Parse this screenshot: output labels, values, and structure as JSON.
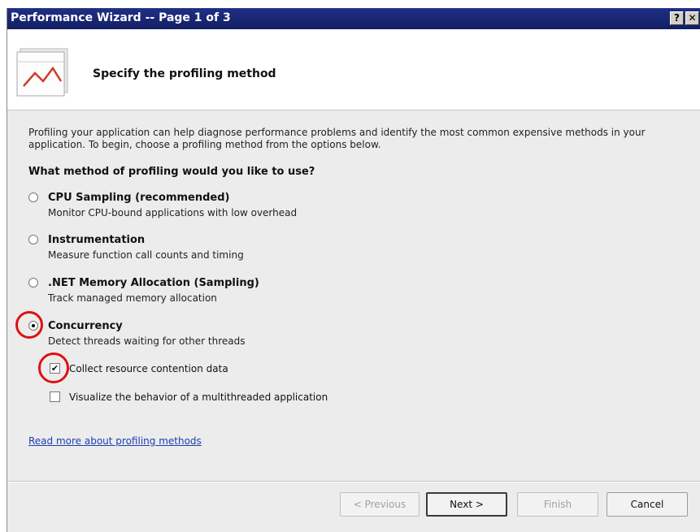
{
  "window": {
    "title": "Performance Wizard -- Page 1 of 3",
    "help_label": "?",
    "close_label": "✕"
  },
  "header": {
    "title": "Specify the profiling method",
    "icon": "line-chart-icon"
  },
  "content": {
    "intro": "Profiling your application can help diagnose performance problems and identify the most common expensive methods in your application. To begin, choose a profiling method from the options below.",
    "question": "What method of profiling would you like to use?",
    "options": [
      {
        "label": "CPU Sampling (recommended)",
        "description": "Monitor CPU-bound applications with low overhead",
        "selected": false
      },
      {
        "label": "Instrumentation",
        "description": "Measure function call counts and timing",
        "selected": false
      },
      {
        "label": ".NET Memory Allocation (Sampling)",
        "description": "Track managed memory allocation",
        "selected": false
      },
      {
        "label": "Concurrency",
        "description": "Detect threads waiting for other threads",
        "selected": true
      }
    ],
    "checkboxes": [
      {
        "label": "Collect resource contention data",
        "checked": true
      },
      {
        "label": "Visualize the behavior of a multithreaded application",
        "checked": false
      }
    ],
    "link": "Read more about profiling methods"
  },
  "buttons": {
    "previous": "< Previous",
    "next": "Next >",
    "finish": "Finish",
    "cancel": "Cancel"
  },
  "annotation_color": "#e01010"
}
